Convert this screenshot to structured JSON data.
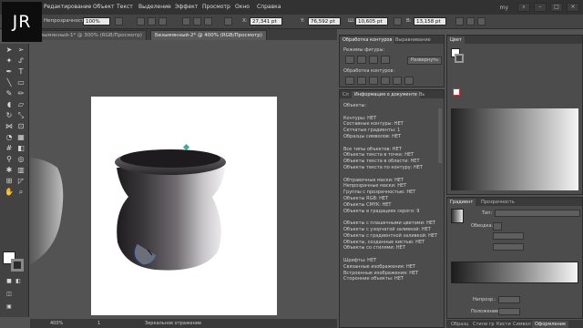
{
  "logo": "JR",
  "menu": [
    "Редактирование",
    "Объект",
    "Текст",
    "Выделение",
    "Эффект",
    "Просмотр",
    "Окно",
    "Справка"
  ],
  "workspace": "my",
  "control": {
    "opacity_label": "Непрозрачность:",
    "opacity_value": "100%",
    "x_label": "X:",
    "x_value": "27,341 pt",
    "y_label": "Y:",
    "y_value": "76,592 pt",
    "w_label": "Ш:",
    "w_value": "10,605 pt",
    "h_label": "В:",
    "h_value": "13,158 pt"
  },
  "tabs": [
    "Безымянный-1* @ 300% (RGB/Просмотр)",
    "Безымянный-2* @ 400% (RGB/Просмотр)"
  ],
  "status": {
    "zoom": "400%",
    "page": "1",
    "info": "Зеркальное отражение"
  },
  "pathfinder": {
    "tabs": [
      "Обработка контуров",
      "Выравнивание"
    ],
    "shape_modes": "Режимы фигуры:",
    "expand": "Развернуть",
    "pathfinders": "Обработка контуров:"
  },
  "docinfo": {
    "tabs": [
      "Сл",
      "Информация о документе",
      "Вь"
    ],
    "lines": [
      "Объекты:",
      "",
      "Контуры: НЕТ",
      "Составные контуры: НЕТ",
      "Сетчатые градиенты: 1",
      "Образцы символов: НЕТ",
      "",
      "Все типы объектов: НЕТ",
      "Объекты текста в точке: НЕТ",
      "Объекты текста в области: НЕТ",
      "Объекты текста по контуру: НЕТ",
      "",
      "Обтравочные маски: НЕТ",
      "Непрозрачные маски: НЕТ",
      "Группы с прозрачностью: НЕТ",
      "Объекты RGB: НЕТ",
      "Объекты CMYK: НЕТ",
      "Объекты в градациях серого: 9",
      "",
      "Объекты с плашечными цветами: НЕТ",
      "Объекты с узорчатой заливкой: НЕТ",
      "Объекты с градиентной заливкой: НЕТ",
      "Объекты, созданные кистью: НЕТ",
      "Объекты со стилями: НЕТ",
      "",
      "Шрифты: НЕТ",
      "Связанные изображения: НЕТ",
      "Встроенные изображения: НЕТ",
      "Сторонние объекты: НЕТ"
    ]
  },
  "color_panel": {
    "tab": "Цвет"
  },
  "gradient_panel": {
    "tabs": [
      "Градиент",
      "Прозрачность"
    ],
    "type_label": "Тип:",
    "angle_label": "Обводка:",
    "opacity_label": "Непрозр.:",
    "location_label": "Положение:"
  },
  "bottom_tabs": [
    "Образц",
    "Стили гр",
    "Кисти",
    "Символ",
    "Оформление"
  ],
  "colors": {
    "ui_dark": "#323232",
    "panel": "#4c4c4c",
    "canvas": "#535353",
    "artboard": "#ffffff"
  }
}
